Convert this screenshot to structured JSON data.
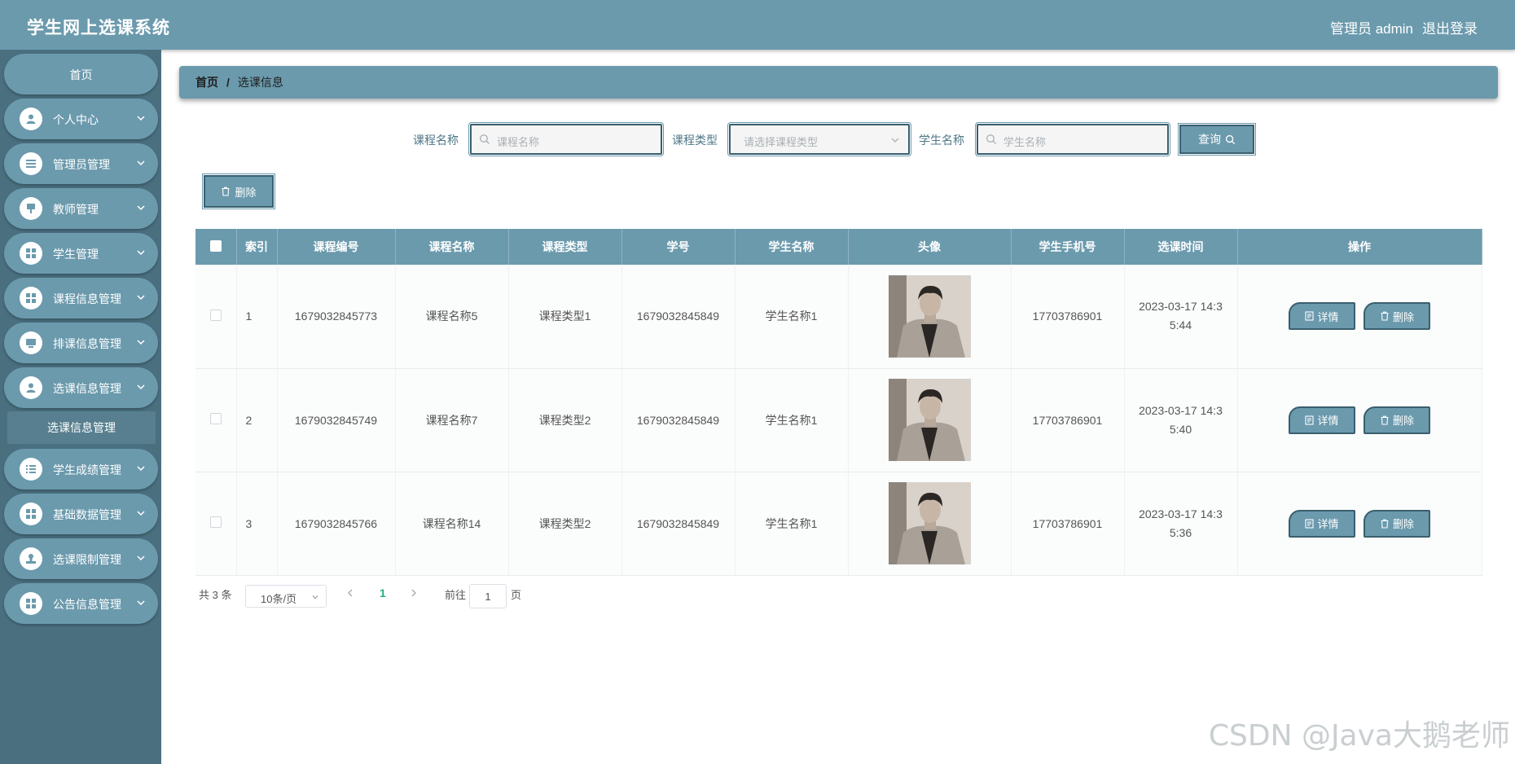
{
  "header": {
    "title": "学生网上选课系统",
    "user_label": "管理员 admin",
    "logout": "退出登录"
  },
  "sidebar": {
    "home": "首页",
    "items": [
      {
        "label": "个人中心",
        "icon": "user-icon"
      },
      {
        "label": "管理员管理",
        "icon": "list-icon"
      },
      {
        "label": "教师管理",
        "icon": "teacher-icon"
      },
      {
        "label": "学生管理",
        "icon": "grid-icon"
      },
      {
        "label": "课程信息管理",
        "icon": "grid-icon"
      },
      {
        "label": "排课信息管理",
        "icon": "monitor-icon"
      },
      {
        "label": "选课信息管理",
        "icon": "user-icon"
      },
      {
        "label": "学生成绩管理",
        "icon": "list-icon"
      },
      {
        "label": "基础数据管理",
        "icon": "grid-icon"
      },
      {
        "label": "选课限制管理",
        "icon": "stamp-icon"
      },
      {
        "label": "公告信息管理",
        "icon": "grid-icon"
      }
    ],
    "active_sub": "选课信息管理"
  },
  "breadcrumb": {
    "home": "首页",
    "separator": "/",
    "current": "选课信息"
  },
  "search": {
    "course_name_label": "课程名称",
    "course_name_placeholder": "课程名称",
    "course_type_label": "课程类型",
    "course_type_placeholder": "请选择课程类型",
    "student_name_label": "学生名称",
    "student_name_placeholder": "学生名称",
    "query": "查询"
  },
  "actions": {
    "batch_delete": "删除"
  },
  "table": {
    "headers": [
      "索引",
      "课程编号",
      "课程名称",
      "课程类型",
      "学号",
      "学生名称",
      "头像",
      "学生手机号",
      "选课时间",
      "操作"
    ],
    "rows": [
      {
        "index": "1",
        "course_no": "1679032845773",
        "course_name": "课程名称5",
        "course_type": "课程类型1",
        "student_no": "1679032845849",
        "student_name": "学生名称1",
        "phone": "17703786901",
        "time_line1": "2023-03-17 14:3",
        "time_line2": "5:44"
      },
      {
        "index": "2",
        "course_no": "1679032845749",
        "course_name": "课程名称7",
        "course_type": "课程类型2",
        "student_no": "1679032845849",
        "student_name": "学生名称1",
        "phone": "17703786901",
        "time_line1": "2023-03-17 14:3",
        "time_line2": "5:40"
      },
      {
        "index": "3",
        "course_no": "1679032845766",
        "course_name": "课程名称14",
        "course_type": "课程类型2",
        "student_no": "1679032845849",
        "student_name": "学生名称1",
        "phone": "17703786901",
        "time_line1": "2023-03-17 14:3",
        "time_line2": "5:36"
      }
    ],
    "detail_btn": "详情",
    "delete_btn": "删除"
  },
  "pagination": {
    "total": "共 3 条",
    "page_size": "10条/页",
    "current_page": "1",
    "goto_prefix": "前往",
    "goto_value": "1",
    "goto_suffix": "页"
  },
  "watermark": "CSDN @Java大鹅老师",
  "colors": {
    "primary": "#6b9aad",
    "sidebar_bg": "#4a7080",
    "border_dark": "#3a5f6e",
    "active_page": "#2ea789"
  }
}
